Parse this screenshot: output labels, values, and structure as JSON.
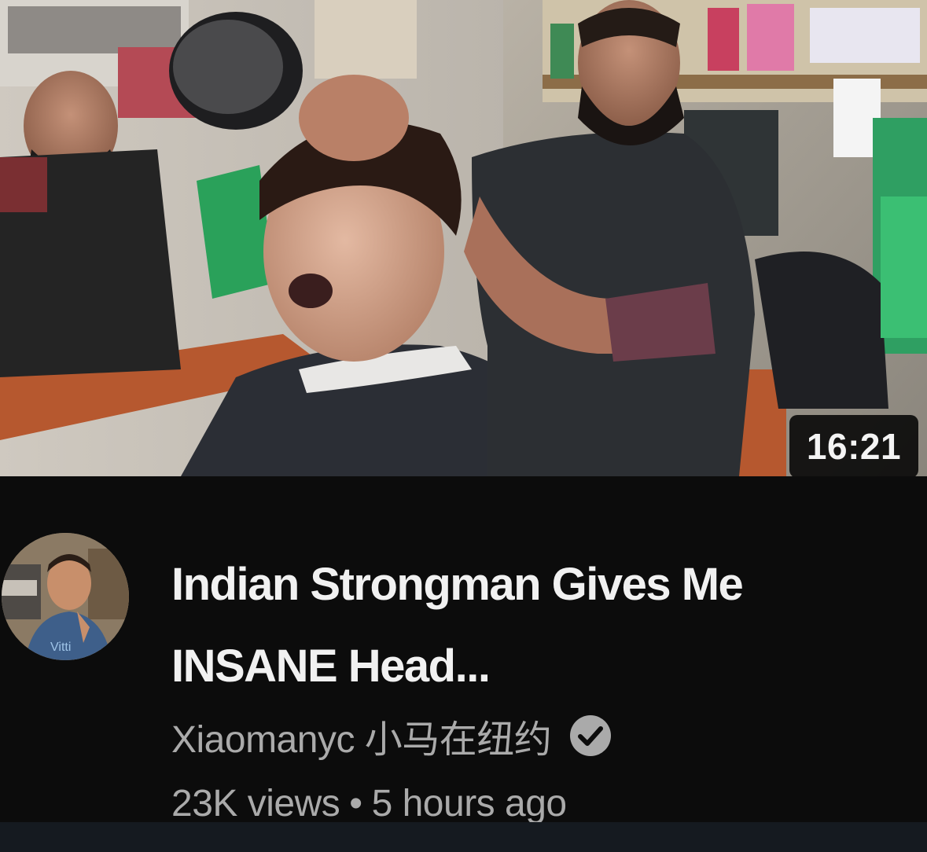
{
  "video": {
    "duration": "16:21",
    "title": "Indian Strongman Gives Me INSANE Head...",
    "channel_name": "Xiaomanyc 小马在纽约",
    "views": "23K views",
    "separator": "•",
    "published": "5 hours ago"
  },
  "icons": {
    "verified": "check-circle-icon"
  },
  "colors": {
    "background": "#0c0c0c",
    "title_text": "#f1f1f1",
    "secondary_text": "#aaaaaa",
    "duration_badge_bg": "#050505"
  }
}
